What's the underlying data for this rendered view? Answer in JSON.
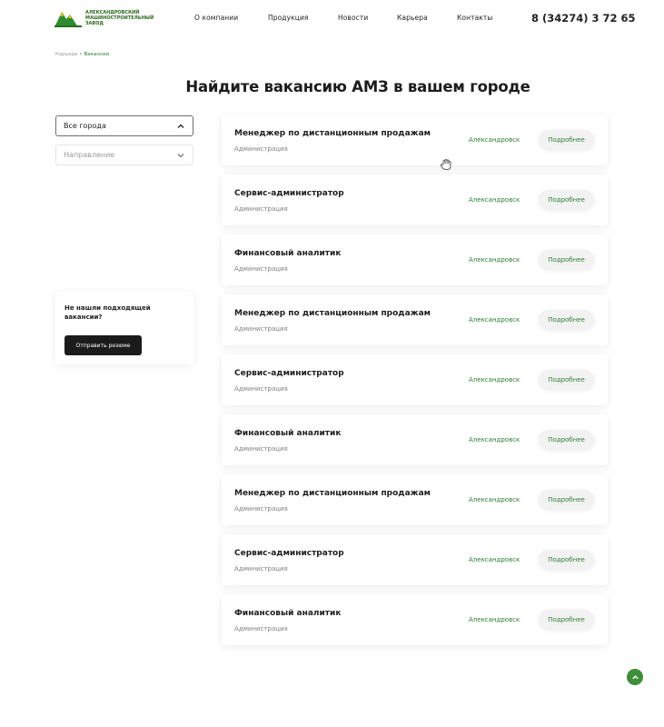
{
  "colors": {
    "brand_green": "#2e7d32",
    "dark_button": "#1b1b1b"
  },
  "logo": {
    "line1": "Александровский",
    "line2": "машиностроительный",
    "line3": "завод",
    "icon": "mountains-logo-icon"
  },
  "nav": {
    "items": [
      "О компании",
      "Продукция",
      "Новости",
      "Карьера",
      "Контакты"
    ]
  },
  "phone": "8 (34274) 3 72 65",
  "breadcrumb": {
    "parent": "Карьера",
    "separator": "•",
    "current": "Вакансии"
  },
  "page_title": "Найдите вакансию АМЗ в вашем городе",
  "filters": {
    "city": {
      "value": "Все города",
      "icon": "chevron-up-icon"
    },
    "direction": {
      "placeholder": "Направление",
      "icon": "chevron-down-icon"
    }
  },
  "help": {
    "text": "Не нашли подходящей вакансии?",
    "button": "Отправить резюме"
  },
  "vacancies": [
    {
      "title": "Менеджер по дистанционным продажам",
      "dept": "Администрация",
      "city": "Александровск",
      "button": "Подробнее"
    },
    {
      "title": "Сервис-администратор",
      "dept": "Администрация",
      "city": "Александровск",
      "button": "Подробнее"
    },
    {
      "title": "Финансовый аналитик",
      "dept": "Администрация",
      "city": "Александровск",
      "button": "Подробнее"
    },
    {
      "title": "Менеджер по дистанционным продажам",
      "dept": "Администрация",
      "city": "Александровск",
      "button": "Подробнее"
    },
    {
      "title": "Сервис-администратор",
      "dept": "Администрация",
      "city": "Александровск",
      "button": "Подробнее"
    },
    {
      "title": "Финансовый аналитик",
      "dept": "Администрация",
      "city": "Александровск",
      "button": "Подробнее"
    },
    {
      "title": "Менеджер по дистанционным продажам",
      "dept": "Администрация",
      "city": "Александровск",
      "button": "Подробнее"
    },
    {
      "title": "Сервис-администратор",
      "dept": "Администрация",
      "city": "Александровск",
      "button": "Подробнее"
    },
    {
      "title": "Финансовый аналитик",
      "dept": "Администрация",
      "city": "Александровск",
      "button": "Подробнее"
    }
  ],
  "scroll_top_icon": "arrow-up-icon"
}
